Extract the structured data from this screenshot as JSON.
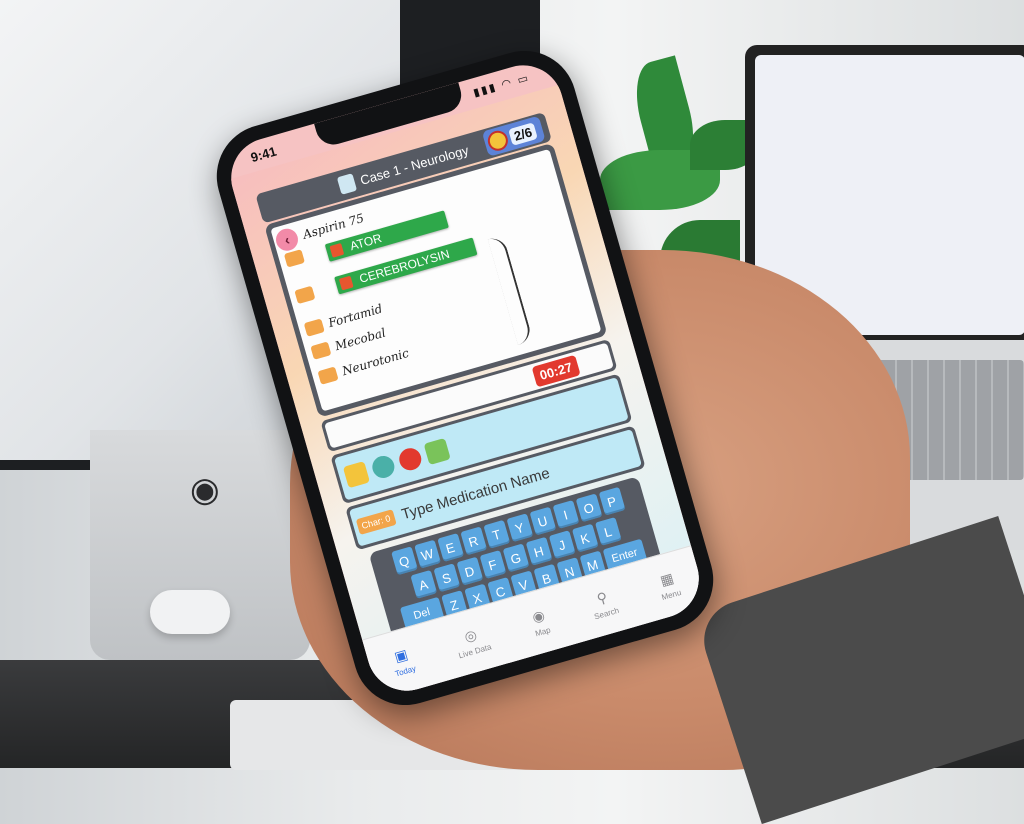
{
  "status_bar": {
    "time": "9:41",
    "signal": "▮▮▮ ◠ ▭"
  },
  "header": {
    "title": "Case 1 - Neurology",
    "level": "2/6"
  },
  "prescription": {
    "lines": [
      "Aspirin 75",
      "Ator",
      "Cerebrolysin",
      "Fortamid",
      "Mecobal",
      "Neurotonic"
    ],
    "meds": [
      {
        "label": "ATOR"
      },
      {
        "label": "CEREBROLYSIN"
      }
    ]
  },
  "timer": {
    "value": "00:27"
  },
  "input": {
    "char_label": "Char: 0",
    "placeholder": "Type Medication Name"
  },
  "keyboard": {
    "rows": [
      [
        "Q",
        "W",
        "E",
        "R",
        "T",
        "Y",
        "U",
        "I",
        "O",
        "P"
      ],
      [
        "A",
        "S",
        "D",
        "F",
        "G",
        "H",
        "J",
        "K",
        "L"
      ],
      [
        "Z",
        "X",
        "C",
        "V",
        "B",
        "N",
        "M"
      ]
    ],
    "del_label": "Del",
    "enter_label": "Enter"
  },
  "tabs": [
    {
      "label": "Today",
      "icon": "today-icon"
    },
    {
      "label": "Live Data",
      "icon": "live-data-icon"
    },
    {
      "label": "Map",
      "icon": "map-icon"
    },
    {
      "label": "Search",
      "icon": "search-icon"
    },
    {
      "label": "Menu",
      "icon": "menu-icon"
    }
  ],
  "colors": {
    "accent": "#2ea84a",
    "timer": "#e2392e",
    "key": "#5aa6e0",
    "panel": "#565a63"
  }
}
